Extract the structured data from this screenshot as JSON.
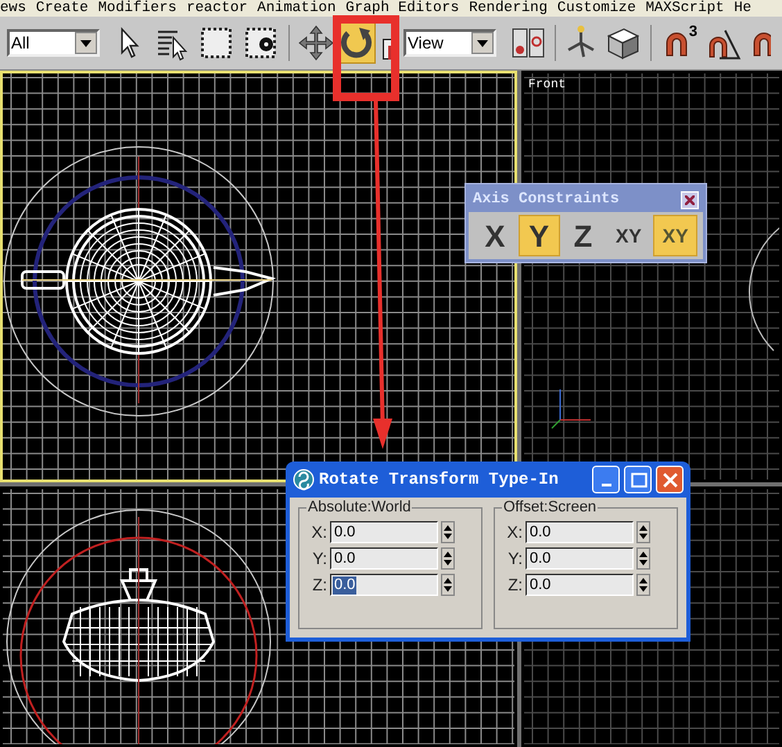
{
  "menu": [
    "ews",
    "Create",
    "Modifiers",
    "reactor",
    "Animation",
    "Graph Editors",
    "Rendering",
    "Customize",
    "MAXScript",
    "He"
  ],
  "toolbar": [
    {
      "kind": "dropdown",
      "value": "All"
    },
    {
      "kind": "select",
      "selected": false
    },
    {
      "kind": "select-by-name",
      "selected": false
    },
    {
      "kind": "rect-region",
      "selected": false
    },
    {
      "kind": "window-crossing",
      "selected": false
    },
    {
      "kind": "divider"
    },
    {
      "kind": "move",
      "selected": false
    },
    {
      "kind": "rotate",
      "selected": true
    },
    {
      "kind": "scale",
      "selected": false
    },
    {
      "kind": "dropdown",
      "value": "View"
    },
    {
      "kind": "pivot",
      "selected": false
    },
    {
      "kind": "divider"
    },
    {
      "kind": "tripod",
      "selected": false
    },
    {
      "kind": "box",
      "selected": false
    },
    {
      "kind": "divider"
    },
    {
      "kind": "snap",
      "label": "3",
      "selected": false
    },
    {
      "kind": "angle-snap",
      "selected": false
    },
    {
      "kind": "magnet",
      "selected": false
    }
  ],
  "viewports": [
    {
      "kind": "teapot-top",
      "active": true
    },
    {
      "kind": "front",
      "label": "Front",
      "active": false
    },
    {
      "kind": "teapot-side",
      "active": false
    },
    {
      "kind": "empty",
      "active": false
    }
  ],
  "axis_constraints": {
    "title": "Axis Constraints",
    "buttons": [
      {
        "label": "X",
        "selected": false
      },
      {
        "label": "Y",
        "selected": true
      },
      {
        "label": "Z",
        "selected": false
      },
      {
        "label": "XY",
        "selected": false
      },
      {
        "label": "XY",
        "selected": true,
        "kind": "flyout"
      }
    ]
  },
  "dialog": {
    "title": "Rotate Transform Type-In",
    "groups": [
      {
        "title": "Absolute:World",
        "fields": [
          {
            "label": "X:",
            "value": "0.0",
            "selected": false
          },
          {
            "label": "Y:",
            "value": "0.0",
            "selected": false
          },
          {
            "label": "Z:",
            "value": "0.0",
            "selected": true
          }
        ]
      },
      {
        "title": "Offset:Screen",
        "fields": [
          {
            "label": "X:",
            "value": "0.0",
            "selected": false
          },
          {
            "label": "Y:",
            "value": "0.0",
            "selected": false
          },
          {
            "label": "Z:",
            "value": "0.0",
            "selected": false
          }
        ]
      }
    ]
  }
}
